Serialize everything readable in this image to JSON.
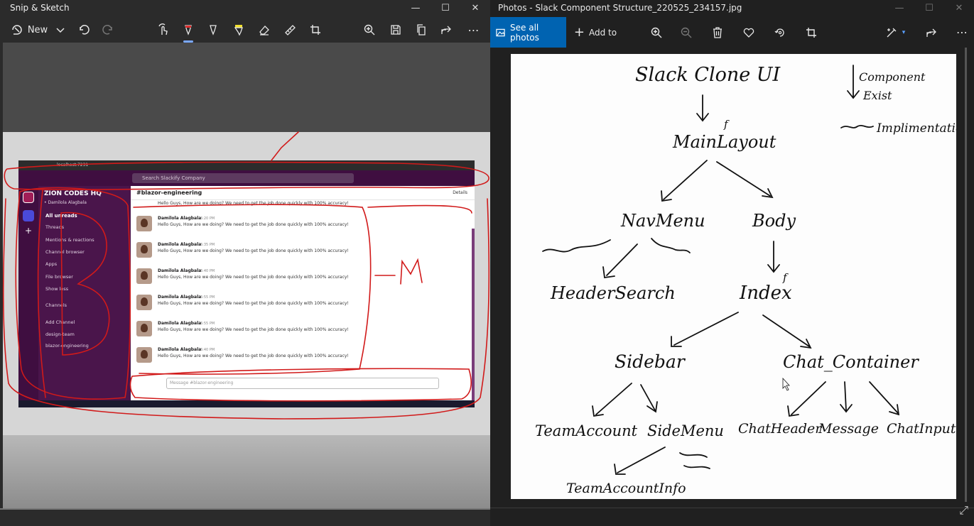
{
  "snip": {
    "title": "Snip & Sketch",
    "new_label": "New",
    "window_controls": [
      "—",
      "☐",
      "✕"
    ],
    "embedded": {
      "url": "localhost:7231",
      "search_placeholder": "Search Slackify Company",
      "workspace_name": "ZION CODES HQ",
      "workspace_user": "• Damilola Alagbala",
      "sidebar_items": [
        "All unreads",
        "Threads",
        "Mentions & reactions",
        "Channel browser",
        "Apps",
        "File browser",
        "Show less",
        "Channels",
        "Add Channel",
        "design-team",
        "blazor-engineering"
      ],
      "channel_name": "#blazor-engineering",
      "details_label": "Details",
      "messages": [
        {
          "author": "Damilola Alagbala",
          "time": "6:20 PM",
          "text": "Hello Guys, How are we doing? We need to get the job done quickly with 100% accuracy!"
        },
        {
          "author": "Damilola Alagbala",
          "time": "6:35 PM",
          "text": "Hello Guys, How are we doing? We need to get the job done quickly with 100% accuracy!"
        },
        {
          "author": "Damilola Alagbala",
          "time": "6:40 PM",
          "text": "Hello Guys, How are we doing? We need to get the job done quickly with 100% accuracy!"
        },
        {
          "author": "Damilola Alagbala",
          "time": "6:55 PM",
          "text": "Hello Guys, How are we doing? We need to get the job done quickly with 100% accuracy!"
        },
        {
          "author": "Damilola Alagbala",
          "time": "6:55 PM",
          "text": "Hello Guys, How are we doing? We need to get the job done quickly with 100% accuracy!"
        },
        {
          "author": "Damilola Alagbala",
          "time": "6:40 PM",
          "text": "Hello Guys, How are we doing? We need to get the job done quickly with 100% accuracy!"
        }
      ],
      "partial_message": "Hello Guys, How are we doing? We need to get the job done quickly with 100% accuracy!",
      "message_placeholder": "Message #blazor-engineering"
    },
    "annotation_letters": [
      "M",
      "B"
    ]
  },
  "photos": {
    "title": "Photos - Slack Component Structure_220525_234157.jpg",
    "see_all_label": "See all photos",
    "add_to_label": "Add to",
    "window_controls": [
      "—",
      "☐",
      "✕"
    ]
  },
  "whiteboard": {
    "root": "Slack Clone UI",
    "legend_1": "Component",
    "legend_2": "Exist",
    "legend_3": "Implimentation",
    "main_layout": "MainLayout",
    "f_mark": "f",
    "nav_menu": "NavMenu",
    "body": "Body",
    "header_search": "HeaderSearch",
    "index": "Index",
    "sidebar": "Sidebar",
    "chat_container": "Chat_Container",
    "team_account": "TeamAccount",
    "side_menu": "SideMenu",
    "chat_header": "ChatHeader",
    "message": "Message",
    "chat_input": "ChatInput",
    "team_account_info": "TeamAccountInfo"
  }
}
